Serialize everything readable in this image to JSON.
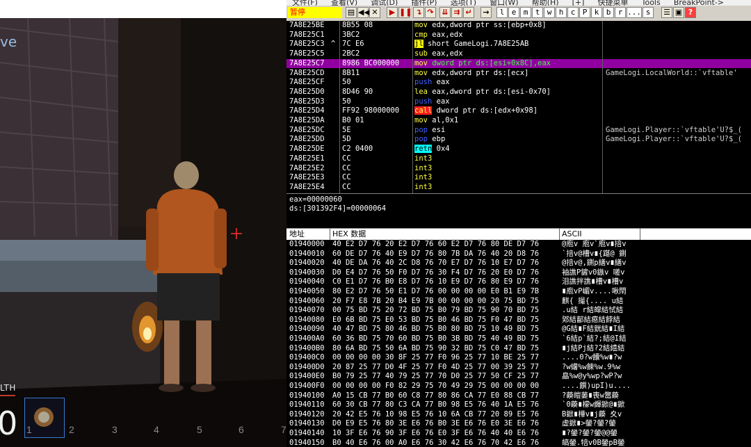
{
  "game": {
    "title_fragment": "ve",
    "health_label_fragment": "LTH",
    "health_value_fragment": "0",
    "hotbar": [
      "1",
      "2",
      "3",
      "4",
      "5",
      "6",
      "7"
    ]
  },
  "debugger": {
    "menu": [
      "文件(F)",
      "查看(V)",
      "调试(D)",
      "插件(P)",
      "选项(T)",
      "窗口(W)",
      "帮助(H)",
      "[+]",
      "快捷菜单",
      "Tools",
      "BreakPoint->"
    ],
    "status": "暂停",
    "toolbar_letters": [
      "l",
      "e",
      "m",
      "t",
      "w",
      "h",
      "c",
      "P",
      "k",
      "b",
      "r",
      "...",
      "s"
    ],
    "disasm_rows": [
      {
        "addr": "7A8E25BE",
        "flag": "",
        "hex": "8B55 08",
        "op": "mov",
        "opclass": "op-mov",
        "args": "edx,dword ptr ss:[ebp+0x8]",
        "comment": ""
      },
      {
        "addr": "7A8E25C1",
        "flag": "",
        "hex": "3BC2",
        "op": "cmp",
        "opclass": "op-cmp",
        "args": "eax,edx",
        "comment": ""
      },
      {
        "addr": "7A8E25C3",
        "flag": "^",
        "hex": "7C E6",
        "op": "jl",
        "opclass": "op-jl",
        "args": "short GameLogi.7A8E25AB",
        "comment": ""
      },
      {
        "addr": "7A8E25C5",
        "flag": "",
        "hex": "2BC2",
        "op": "sub",
        "opclass": "op-sub",
        "args": "eax,edx",
        "comment": ""
      },
      {
        "addr": "7A8E25C7",
        "flag": "",
        "hex": "8986 BC000000",
        "op": "mov",
        "opclass": "op-mov",
        "args": "dword ptr ds:[esi+0x8C],eax",
        "comment": "",
        "selected": true
      },
      {
        "addr": "7A8E25CD",
        "flag": "",
        "hex": "8B11",
        "op": "mov",
        "opclass": "op-mov",
        "args": "edx,dword ptr ds:[ecx]",
        "comment": "GameLogi.LocalWorld::`vftable'"
      },
      {
        "addr": "7A8E25CF",
        "flag": "",
        "hex": "50",
        "op": "push",
        "opclass": "op-push",
        "args": "eax",
        "comment": ""
      },
      {
        "addr": "7A8E25D0",
        "flag": "",
        "hex": "8D46 90",
        "op": "lea",
        "opclass": "op-lea",
        "args": "eax,dword ptr ds:[esi-0x70]",
        "comment": ""
      },
      {
        "addr": "7A8E25D3",
        "flag": "",
        "hex": "50",
        "op": "push",
        "opclass": "op-push",
        "args": "eax",
        "comment": ""
      },
      {
        "addr": "7A8E25D4",
        "flag": "",
        "hex": "FF92 98000000",
        "op": "call",
        "opclass": "op-call",
        "args": "dword ptr ds:[edx+0x98]",
        "comment": ""
      },
      {
        "addr": "7A8E25DA",
        "flag": "",
        "hex": "B0 01",
        "op": "mov",
        "opclass": "op-mov",
        "args": "al,0x1",
        "comment": ""
      },
      {
        "addr": "7A8E25DC",
        "flag": "",
        "hex": "5E",
        "op": "pop",
        "opclass": "op-pop",
        "args": "esi",
        "comment": "GameLogi.Player::`vftable'U?$_("
      },
      {
        "addr": "7A8E25DD",
        "flag": "",
        "hex": "5D",
        "op": "pop",
        "opclass": "op-pop",
        "args": "ebp",
        "comment": "GameLogi.Player::`vftable'U?$_("
      },
      {
        "addr": "7A8E25DE",
        "flag": "",
        "hex": "C2 0400",
        "op": "retn",
        "opclass": "op-retn",
        "args": "0x4",
        "comment": ""
      },
      {
        "addr": "7A8E25E1",
        "flag": "",
        "hex": "CC",
        "op": "int3",
        "opclass": "op-int",
        "args": "",
        "comment": ""
      },
      {
        "addr": "7A8E25E2",
        "flag": "",
        "hex": "CC",
        "op": "int3",
        "opclass": "op-int",
        "args": "",
        "comment": ""
      },
      {
        "addr": "7A8E25E3",
        "flag": "",
        "hex": "CC",
        "op": "int3",
        "opclass": "op-int",
        "args": "",
        "comment": ""
      },
      {
        "addr": "7A8E25E4",
        "flag": "",
        "hex": "CC",
        "op": "int3",
        "opclass": "op-int",
        "args": "",
        "comment": ""
      }
    ],
    "info_lines": [
      "eax=00000060",
      "ds:[301392F4]=00000064"
    ],
    "dump_header": {
      "addr": "地址",
      "hex": "HEX 数据",
      "ascii": "ASCII"
    },
    "dump_rows": [
      {
        "addr": "01940000",
        "hex": "40 E2 D7 76 20 E2 D7 76 60 E2 D7 76 80 DE D7 76",
        "ascii": "@庖v 庖v`庖v∎掊v"
      },
      {
        "addr": "01940010",
        "hex": "60 DE D7 76 40 E9 D7 76 80 7B DA 76 40 20 D8 76",
        "ascii": "`掊v@槽v∎{踸@ 鍘"
      },
      {
        "addr": "01940020",
        "hex": "40 DE DA 76 40 2C D8 76 70 E7 D7 76 10 E7 D7 76",
        "ascii": "@掊v@,鍘p繕v∎繕v"
      },
      {
        "addr": "01940030",
        "hex": "D0 E4 D7 76 50 F0 D7 76 30 F4 D7 76 20 E0 D7 76",
        "ascii": "袖譙P鏟v0鏃v 嗟v"
      },
      {
        "addr": "01940040",
        "hex": "C0 E1 D7 76 B0 E8 D7 76 10 E9 D7 76 80 E9 D7 76",
        "ascii": "泪譙拌譙∎槽v∎槽v"
      },
      {
        "addr": "01940050",
        "hex": "80 E2 D7 76 50 E1 D7 76 00 00 00 00 E0 B1 E9 7B",
        "ascii": "∎庖vP嵋v....啾閈"
      },
      {
        "addr": "01940060",
        "hex": "20 F7 E8 7B 20 B4 E9 7B 00 00 00 00 20 75 BD 75",
        "ascii": " 麒{ 撮{.... u結"
      },
      {
        "addr": "01940070",
        "hex": "00 75 BD 75 20 72 BD 75 B0 79 BD 75 90 70 BD 75",
        "ascii": ".u結 r結皡結恜結"
      },
      {
        "addr": "01940080",
        "hex": "E0 6B BD 75 E0 53 BD 75 B0 46 BD 75 F0 47 BD 75",
        "ascii": "鄈結鄐結癋結餑結"
      },
      {
        "addr": "01940090",
        "hex": "40 47 BD 75 80 46 BD 75 B0 80 BD 75 10 49 BD 75",
        "ascii": "@G結∎F結皝結∎I結"
      },
      {
        "addr": "019400A0",
        "hex": "60 36 BD 75 70 60 BD 75 B0 3B BD 75 40 49 BD 75",
        "ascii": "`6結p`結?;結@I結"
      },
      {
        "addr": "019400B0",
        "hex": "80 6A BD 75 50 6A BD 75 90 32 BD 75 C0 47 BD 75",
        "ascii": "∎j結Pj結?2結繥結"
      },
      {
        "addr": "019400C0",
        "hex": "00 00 00 00 30 8F 25 77 F0 96 25 77 10 BE 25 77",
        "ascii": "....0?w饢%w∎?w"
      },
      {
        "addr": "019400D0",
        "hex": "20 87 25 77 D0 4F 25 77 F0 4D 25 77 00 39 25 77",
        "ascii": " ?w蠴%w餗%w.9%w"
      },
      {
        "addr": "019400E0",
        "hex": "B0 79 25 77 40 79 25 77 70 D0 25 77 50 CF 25 77",
        "ascii": "皛%w@y%wp?wP?w"
      },
      {
        "addr": "019400F0",
        "hex": "00 00 00 00 F0 82 29 75 70 49 29 75 00 00 00 00",
        "ascii": "....饌)upI)u...."
      },
      {
        "addr": "01940100",
        "hex": "A0 15 CB 77 B0 60 C8 77 80 86 CA 77 E0 88 CB 77",
        "ascii": "?藈皚葁∎喪w鄨藈"
      },
      {
        "addr": "01940110",
        "hex": "60 30 CB 77 80 C3 CA 77 B0 98 E5 76 40 1A E5 76",
        "ascii": "`0藈∎檬w皹鍁@∎鍁"
      },
      {
        "addr": "01940120",
        "hex": "20 42 E5 76 10 98 E5 76 10 6A CB 77 20 89 E5 76",
        "ascii": " B鍁∎樺v∎j藈 夊v"
      },
      {
        "addr": "01940130",
        "hex": "D0 E9 E5 76 80 3E E6 76 B0 3E E6 76 E0 3E E6 76",
        "ascii": "虚鍁∎>鎣?鎣?鎣"
      },
      {
        "addr": "01940140",
        "hex": "10 3F E6 76 90 3F E6 76 E0 3F E6 76 40 40 E6 76",
        "ascii": "∎?鎣?鎣?鎣@@鎣"
      },
      {
        "addr": "01940150",
        "hex": "B0 40 E6 76 00 A0 E6 76 30 42 E6 76 70 42 E6 76",
        "ascii": "皜鎣.犃v0B鎣pB鎣"
      }
    ]
  }
}
